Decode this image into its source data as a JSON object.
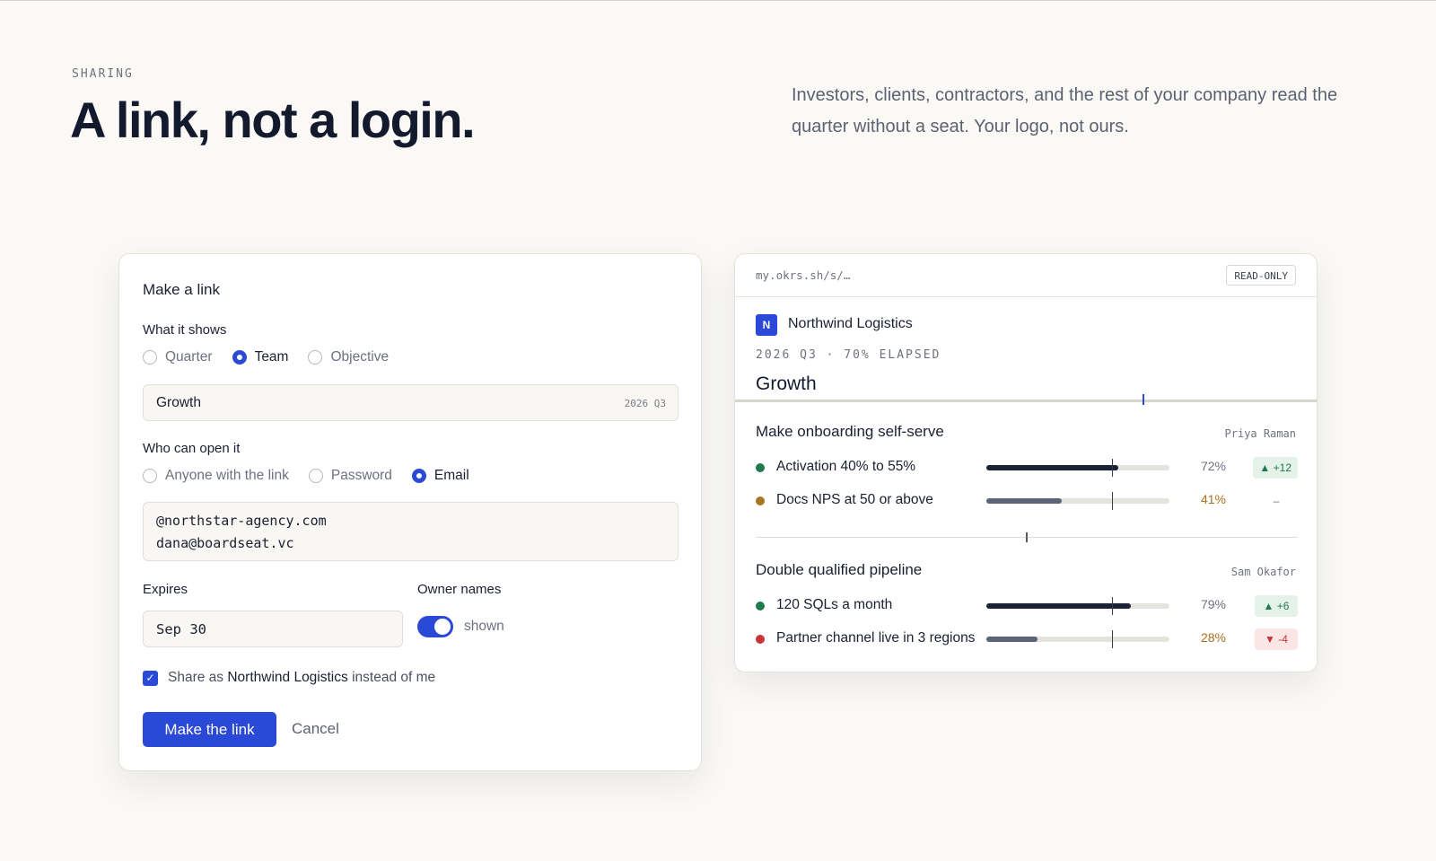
{
  "hero": {
    "eyebrow": "SHARING",
    "headline": "A link, not a login.",
    "lede": "Investors, clients, contractors, and the rest of your company read the quarter without a seat. Your logo, not ours."
  },
  "form": {
    "title": "Make a link",
    "shows": {
      "label": "What it shows",
      "options": [
        "Quarter",
        "Team",
        "Objective"
      ],
      "selected": "Team"
    },
    "scope_field": {
      "value": "Growth",
      "tag": "2026 Q3"
    },
    "access": {
      "label": "Who can open it",
      "options": [
        "Anyone with the link",
        "Password",
        "Email"
      ],
      "selected": "Email"
    },
    "emails": [
      "@northstar-agency.com",
      "dana@boardseat.vc"
    ],
    "expires": {
      "label": "Expires",
      "value": "Sep 30"
    },
    "owner_names": {
      "label": "Owner names",
      "state": "shown",
      "on": true
    },
    "share_as": {
      "checked": true,
      "prefix": "Share as",
      "org": "Northwind Logistics",
      "suffix": "instead of me"
    },
    "submit_label": "Make the link",
    "cancel_label": "Cancel"
  },
  "preview": {
    "url": "my.okrs.sh/s/…",
    "badge": "READ-ONLY",
    "logo_letter": "N",
    "company": "Northwind Logistics",
    "period": "2026 Q3 · 70% ELAPSED",
    "elapsed": 0.7,
    "team": "Growth",
    "objectives": [
      {
        "title": "Make onboarding self-serve",
        "owner": "Priya Raman",
        "krs": [
          {
            "name": "Activation 40% to 55%",
            "progress": 0.72,
            "pct": "72%",
            "delta": "▲ +12",
            "status": "green",
            "trend": "up"
          },
          {
            "name": "Docs NPS at 50 or above",
            "progress": 0.41,
            "pct": "41%",
            "delta": "–",
            "status": "amber",
            "trend": "none"
          }
        ]
      },
      {
        "title": "Double qualified pipeline",
        "owner": "Sam Okafor",
        "krs": [
          {
            "name": "120 SQLs a month",
            "progress": 0.79,
            "pct": "79%",
            "delta": "▲ +6",
            "status": "green",
            "trend": "up"
          },
          {
            "name": "Partner channel live in 3 regions",
            "progress": 0.28,
            "pct": "28%",
            "delta": "▼ -4",
            "status": "red",
            "trend": "down"
          }
        ]
      }
    ]
  },
  "colors": {
    "accent": "#2a49d6",
    "ink": "#141a2e",
    "bar_dark": "#1b2235",
    "bar_muted": "#5b6478",
    "green": "#1f7a4e",
    "amber": "#a87521",
    "red": "#c9313b",
    "pct_amber_text": "#a8701a",
    "pct_muted_text": "#6d7180",
    "delta_up_bg": "#e4f2e9",
    "delta_down_bg": "#fbe6e6"
  }
}
